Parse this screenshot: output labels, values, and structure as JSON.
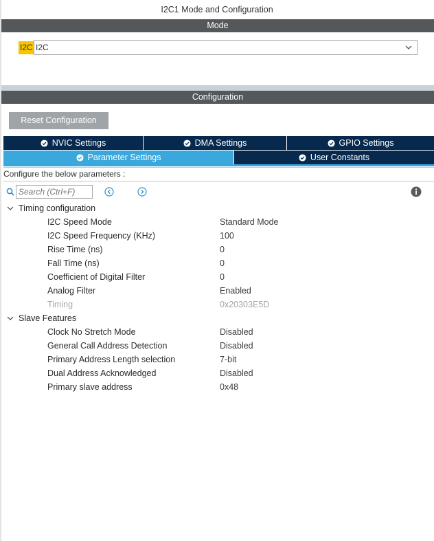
{
  "window": {
    "title": "I2C1 Mode and Configuration"
  },
  "mode_section": {
    "header": "Mode",
    "label": "I2C",
    "selected": "I2C"
  },
  "config_section": {
    "header": "Configuration",
    "reset_button": "Reset Configuration",
    "tabs_row1": [
      {
        "label": "NVIC Settings"
      },
      {
        "label": "DMA Settings"
      },
      {
        "label": "GPIO Settings"
      }
    ],
    "tabs_row2": [
      {
        "label": "Parameter Settings",
        "active": true
      },
      {
        "label": "User Constants",
        "active": false
      }
    ],
    "hint": "Configure the below parameters :",
    "search_placeholder": "Search (Ctrl+F)"
  },
  "groups": [
    {
      "title": "Timing configuration",
      "params": [
        {
          "name": "I2C Speed Mode",
          "value": "Standard Mode"
        },
        {
          "name": "I2C Speed Frequency (KHz)",
          "value": "100"
        },
        {
          "name": "Rise Time (ns)",
          "value": "0"
        },
        {
          "name": "Fall Time (ns)",
          "value": "0"
        },
        {
          "name": "Coefficient of Digital Filter",
          "value": "0"
        },
        {
          "name": "Analog Filter",
          "value": "Enabled"
        },
        {
          "name": "Timing",
          "value": "0x20303E5D",
          "disabled": true
        }
      ]
    },
    {
      "title": "Slave Features",
      "params": [
        {
          "name": "Clock No Stretch Mode",
          "value": "Disabled"
        },
        {
          "name": "General Call Address Detection",
          "value": "Disabled"
        },
        {
          "name": "Primary Address Length selection",
          "value": "7-bit"
        },
        {
          "name": "Dual Address Acknowledged",
          "value": "Disabled"
        },
        {
          "name": "Primary slave address",
          "value": "0x48"
        }
      ]
    }
  ],
  "colors": {
    "header_bg": "#54585a",
    "tab_bg": "#06294d",
    "tab_active": "#3aa8dc",
    "mode_label_bg": "#f7c600",
    "reset_bg": "#9ea4a8"
  },
  "icons": [
    "search-icon",
    "prev-arrow-icon",
    "next-arrow-icon",
    "info-icon",
    "check-circle-icon",
    "chevron-down-icon",
    "collapse-caret-icon"
  ]
}
